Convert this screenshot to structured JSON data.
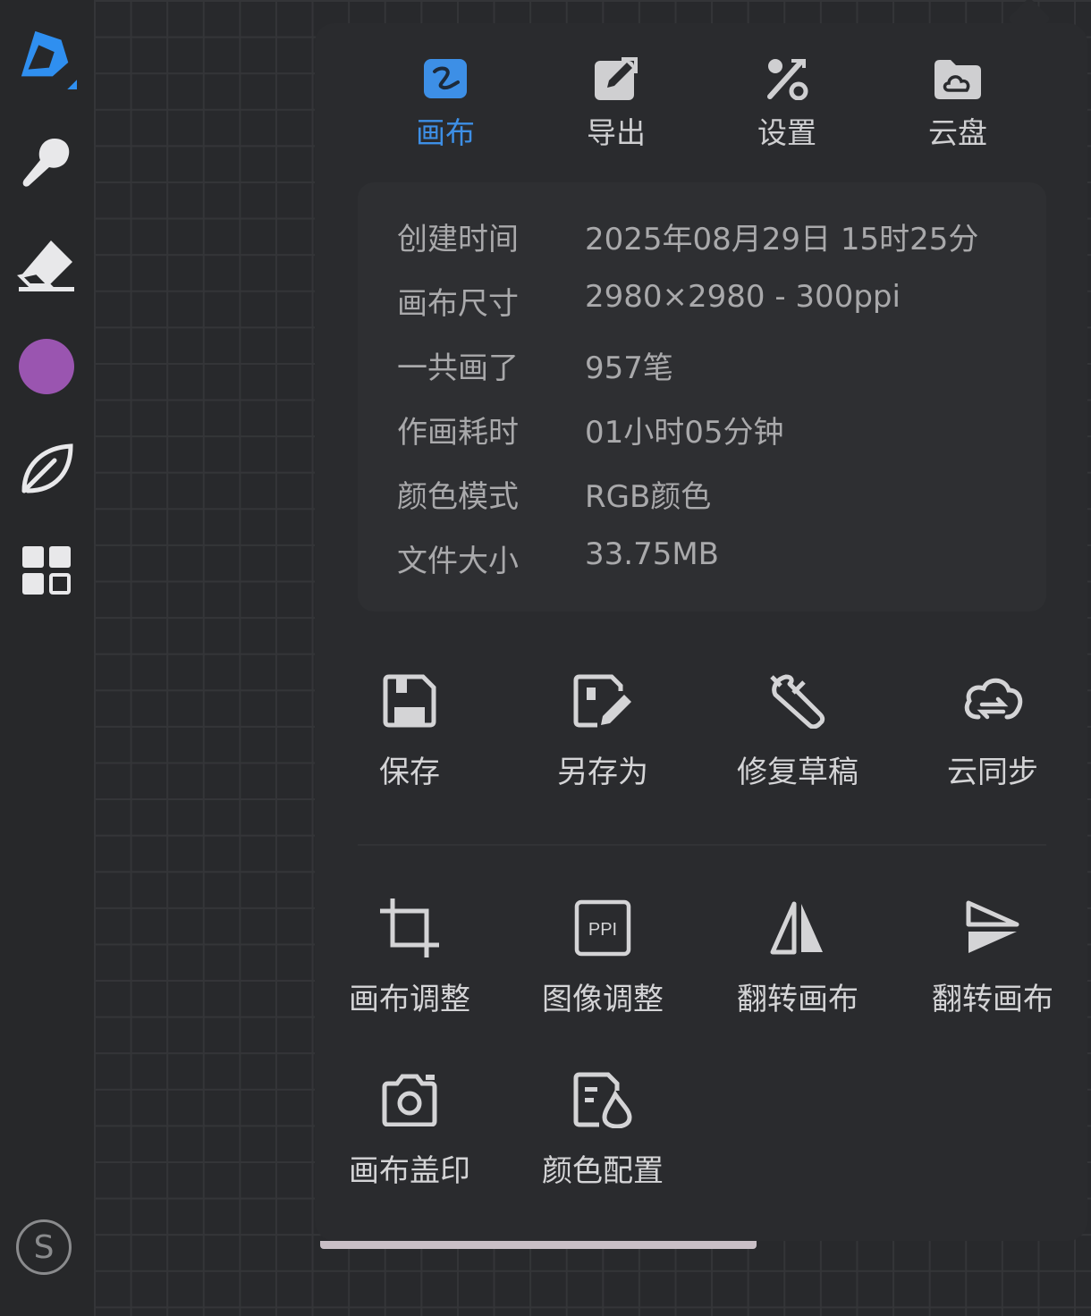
{
  "toolbar": {
    "tools": [
      {
        "name": "brush-pen-icon"
      },
      {
        "name": "smudge-icon"
      },
      {
        "name": "eraser-icon"
      },
      {
        "name": "color-picker"
      },
      {
        "name": "leaf-icon"
      },
      {
        "name": "layers-grid-icon"
      }
    ],
    "active_color": "#9a55b0",
    "avatar_letter": "S"
  },
  "tabs": [
    {
      "label": "画布",
      "icon": "canvas-icon",
      "active": true
    },
    {
      "label": "导出",
      "icon": "export-icon",
      "active": false
    },
    {
      "label": "设置",
      "icon": "settings-tools-icon",
      "active": false
    },
    {
      "label": "云盘",
      "icon": "cloud-drive-icon",
      "active": false
    }
  ],
  "info": [
    {
      "key": "创建时间",
      "value": "2025年08月29日 15时25分"
    },
    {
      "key": "画布尺寸",
      "value": "2980×2980 - 300ppi"
    },
    {
      "key": "一共画了",
      "value": "957笔"
    },
    {
      "key": "作画耗时",
      "value": "01小时05分钟"
    },
    {
      "key": "颜色模式",
      "value": "RGB颜色"
    },
    {
      "key": "文件大小",
      "value": "33.75MB"
    }
  ],
  "actions_primary": [
    {
      "label": "保存",
      "icon": "save-icon"
    },
    {
      "label": "另存为",
      "icon": "save-as-icon"
    },
    {
      "label": "修复草稿",
      "icon": "repair-wrench-icon"
    },
    {
      "label": "云同步",
      "icon": "cloud-sync-icon"
    }
  ],
  "actions_secondary": [
    {
      "label": "画布调整",
      "icon": "crop-icon"
    },
    {
      "label": "图像调整",
      "icon": "ppi-icon"
    },
    {
      "label": "翻转画布",
      "icon": "flip-horizontal-icon"
    },
    {
      "label": "翻转画布",
      "icon": "flip-vertical-icon"
    },
    {
      "label": "画布盖印",
      "icon": "camera-icon"
    },
    {
      "label": "颜色配置",
      "icon": "color-profile-icon"
    }
  ],
  "colors": {
    "accent": "#3d8fe6",
    "panel": "#2a2b2e",
    "text": "#d4d4d6",
    "muted": "#a9a9ab"
  }
}
